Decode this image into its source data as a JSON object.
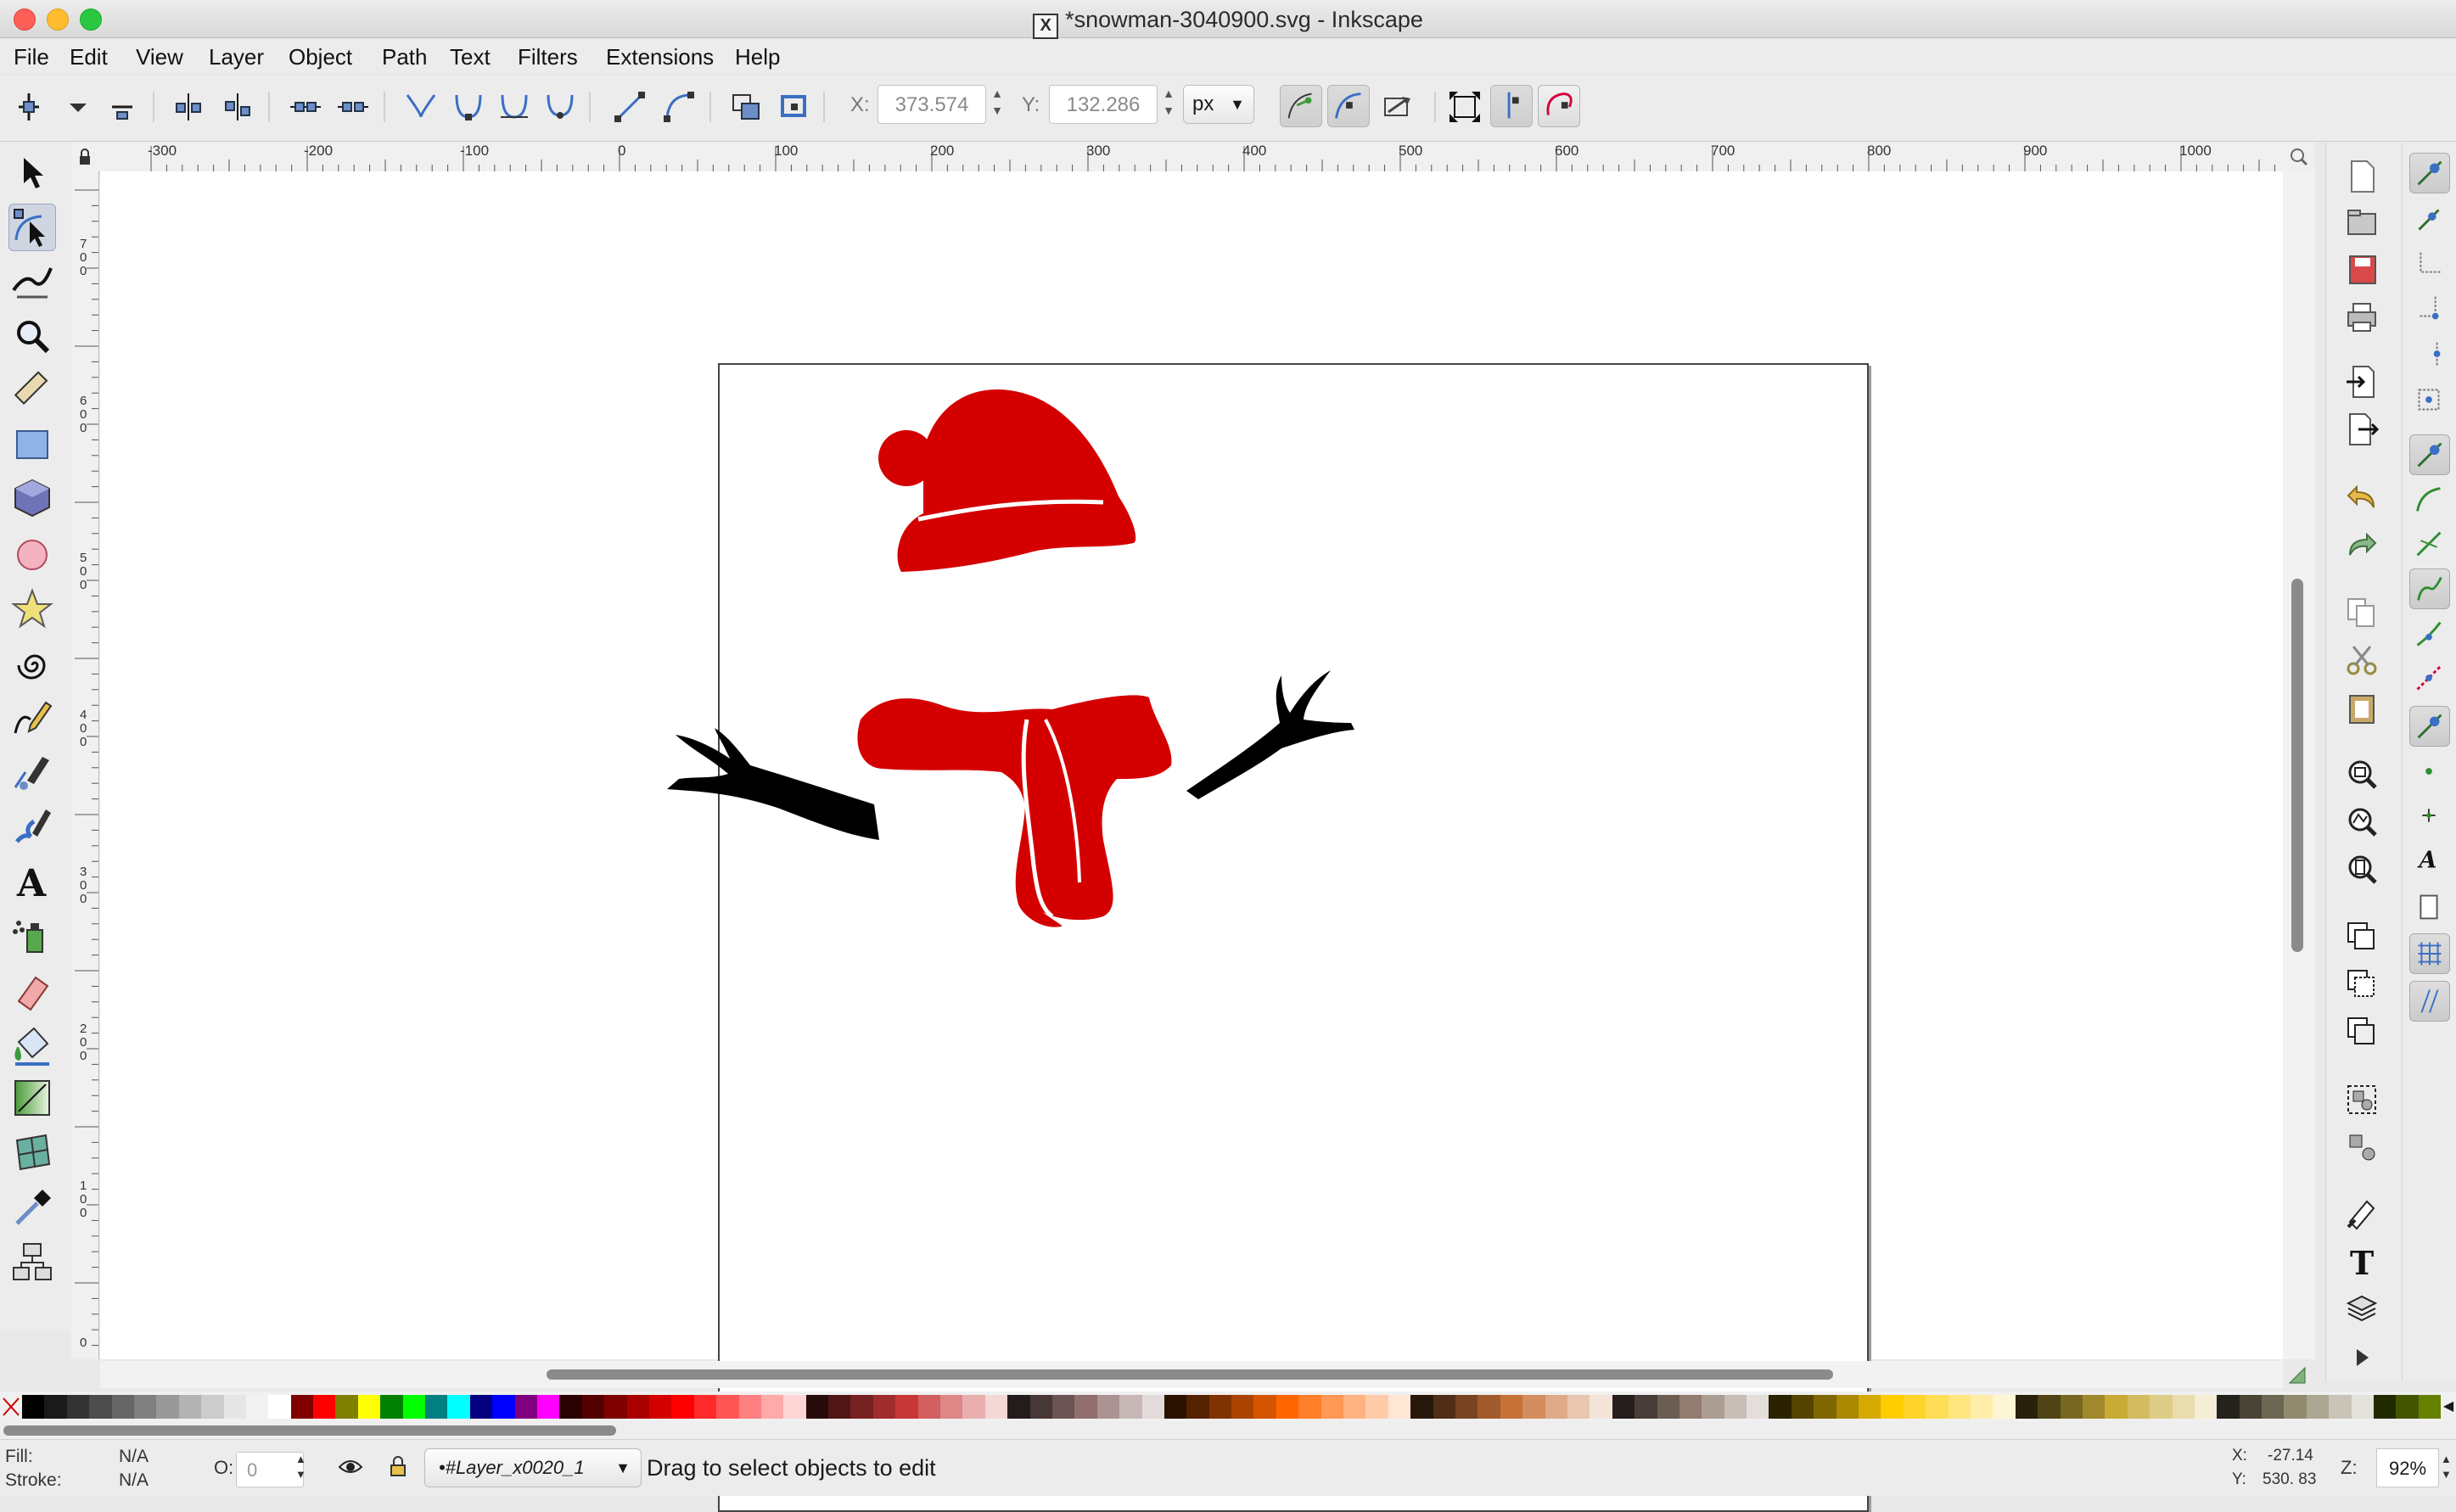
{
  "window": {
    "title": "*snowman-3040900.svg - Inkscape",
    "traffic_lights": {
      "close": "#fe5f57",
      "minimize": "#febc2e",
      "zoom": "#28c840"
    }
  },
  "menubar": {
    "items": [
      "File",
      "Edit",
      "View",
      "Layer",
      "Object",
      "Path",
      "Text",
      "Filters",
      "Extensions",
      "Help"
    ]
  },
  "node_toolbar": {
    "x_label": "X:",
    "x_value": "373.574",
    "y_label": "Y:",
    "y_value": "132.286",
    "unit": "px",
    "icons": [
      "insert-node-icon",
      "insert-node-menu-icon",
      "delete-node-icon",
      "join-nodes-icon",
      "break-path-icon",
      "join-segment-icon",
      "delete-segment-icon",
      "node-cusp-icon",
      "node-smooth-icon",
      "node-symmetric-icon",
      "node-auto-icon",
      "segment-line-icon",
      "segment-curve-icon",
      "object-to-path-icon",
      "stroke-to-path-icon",
      "show-handles-icon",
      "show-path-outline-icon",
      "lpe-edit-icon",
      "transform-handles-icon",
      "show-clipping-path-icon",
      "show-mask-icon"
    ]
  },
  "rulers": {
    "horizontal_labels": [
      "-300",
      "-200",
      "-100",
      "0",
      "100",
      "200",
      "300",
      "400",
      "500",
      "600",
      "700",
      "800",
      "900",
      "1000"
    ],
    "vertical_labels": [
      "700",
      "600",
      "500",
      "400",
      "300",
      "200",
      "100",
      "0"
    ]
  },
  "tools": [
    "selector",
    "node-editor",
    "tweak",
    "zoom",
    "measure",
    "rectangle",
    "3d-box",
    "ellipse",
    "star",
    "spiral",
    "pencil",
    "pen",
    "calligraphy",
    "text",
    "spray",
    "eraser",
    "paint-bucket",
    "gradient",
    "mesh",
    "dropper",
    "connector"
  ],
  "canvas": {
    "drawing_colors": {
      "red": "#d40000",
      "black": "#000000"
    }
  },
  "commands_bar": [
    "new-document",
    "open",
    "save",
    "print",
    "import",
    "export",
    "undo",
    "redo",
    "copy",
    "cut",
    "paste",
    "zoom-selection",
    "zoom-drawing",
    "zoom-page",
    "duplicate",
    "clone",
    "unlink-clone",
    "group",
    "ungroup",
    "fill-stroke",
    "text-font",
    "layers",
    "more"
  ],
  "snap_bar": [
    "snap-enable",
    "snap-bbox",
    "snap-bbox-edge",
    "snap-bbox-corner",
    "snap-bbox-midpoint",
    "snap-bbox-center",
    "snap-nodes",
    "snap-paths",
    "snap-intersections",
    "snap-cusp",
    "snap-smooth",
    "snap-line-midpoints",
    "snap-object-midpoints",
    "snap-rotation-center",
    "snap-text-baseline",
    "snap-page-border",
    "snap-grid",
    "snap-guides"
  ],
  "palette": {
    "colors": [
      "#000000",
      "#1a1a1a",
      "#333333",
      "#4d4d4d",
      "#666666",
      "#808080",
      "#999999",
      "#b3b3b3",
      "#cccccc",
      "#e6e6e6",
      "#f2f2f2",
      "#ffffff",
      "#800000",
      "#ff0000",
      "#808000",
      "#ffff00",
      "#008000",
      "#00ff00",
      "#008080",
      "#00ffff",
      "#000080",
      "#0000ff",
      "#800080",
      "#ff00ff",
      "#2b0000",
      "#550000",
      "#800000",
      "#aa0000",
      "#d40000",
      "#ff0000",
      "#ff2a2a",
      "#ff5555",
      "#ff8080",
      "#ffaaaa",
      "#ffd5d5",
      "#280b0b",
      "#501616",
      "#782121",
      "#a02c2c",
      "#c83737",
      "#d35f5f",
      "#de8787",
      "#e9afaf",
      "#f4d7d7",
      "#241c1c",
      "#483737",
      "#6c5353",
      "#916f6f",
      "#ac9393",
      "#c8b7b7",
      "#e3dbdb",
      "#2b1100",
      "#552200",
      "#803300",
      "#aa4400",
      "#d45500",
      "#ff6600",
      "#ff7f2a",
      "#ff9955",
      "#ffb380",
      "#ffccaa",
      "#ffe6d5",
      "#28170b",
      "#502d16",
      "#784421",
      "#a05a2c",
      "#c87137",
      "#d38d5f",
      "#deaa87",
      "#e9c6af",
      "#f4e3d7",
      "#241f1c",
      "#483e37",
      "#6c5d53",
      "#917c6f",
      "#ac9d93",
      "#c8beb7",
      "#e3dedb",
      "#2b2200",
      "#554400",
      "#806600",
      "#aa8800",
      "#d4aa00",
      "#ffcc00",
      "#ffd42a",
      "#ffdd55",
      "#ffe680",
      "#ffeeaa",
      "#fff6d5",
      "#28220b",
      "#504416",
      "#786721",
      "#a0892c",
      "#c8ab37",
      "#d3bc5f",
      "#decd87",
      "#e9ddaf",
      "#f4eed7",
      "#24221c",
      "#484537",
      "#6c6753",
      "#918a6f",
      "#aca793",
      "#c8c4b7",
      "#e3e2db",
      "#222b00",
      "#445500",
      "#668000"
    ]
  },
  "statusbar": {
    "fill_label": "Fill:",
    "fill_value": "N/A",
    "stroke_label": "Stroke:",
    "stroke_value": "N/A",
    "opacity_label": "O:",
    "opacity_value": "0",
    "layer": "•#Layer_x0020_1",
    "message": "Drag to select objects to edit",
    "cursor_x_label": "X:",
    "cursor_x": "-27.14",
    "cursor_y_label": "Y:",
    "cursor_y": "530. 83",
    "zoom_label": "Z:",
    "zoom_value": "92%"
  }
}
